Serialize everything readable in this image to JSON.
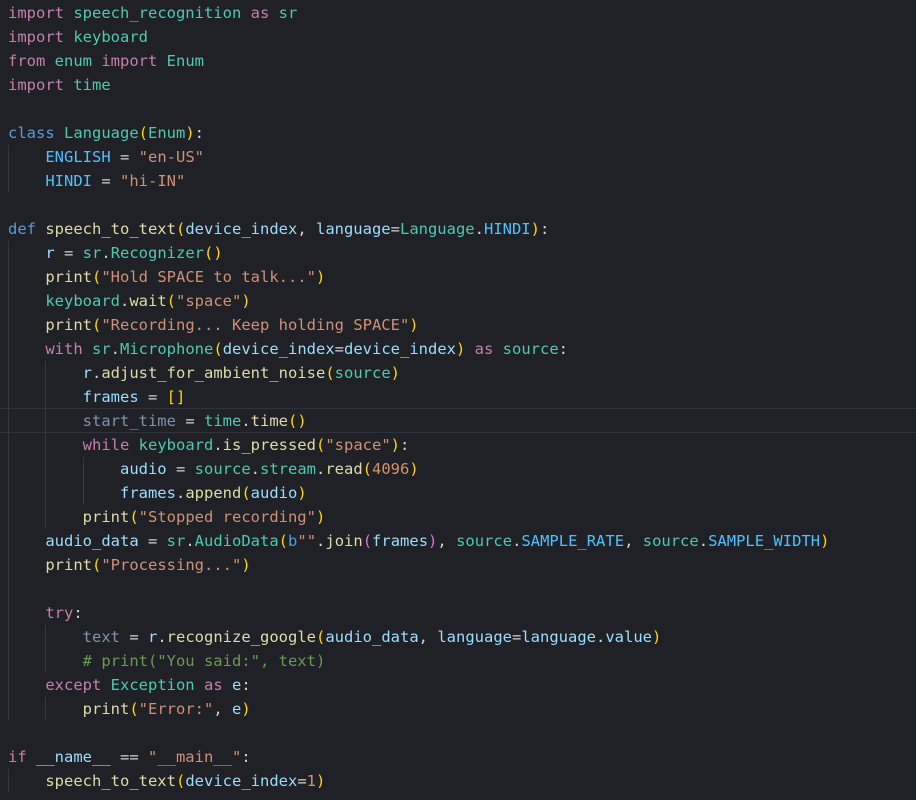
{
  "editor": {
    "kind": "code-editor",
    "language_visual": "python-syntax-highlighted",
    "current_line": 18,
    "palette": {
      "background": "#202127",
      "line_highlight_border": "#30313a",
      "indent_guide": "#36373f",
      "keyword_pink": "#c57fae",
      "keyword_blue": "#569cd6",
      "type_teal": "#4ec9b0",
      "function_yellow": "#dcdcaa",
      "variable_blue": "#9cdcfe",
      "constant_blue": "#4fc1ff",
      "string_salmon": "#ce9178",
      "number_orange": "#d2956b",
      "punctuation": "#d4d4d4",
      "bracket_gold": "#ffd700",
      "bracket_orchid": "#da70d6",
      "comment_green": "#6a9955",
      "unused_dim": "#8093ab"
    },
    "code": {
      "lines": [
        {
          "ind": 0,
          "seg": [
            [
              "k",
              "import "
            ],
            [
              "t",
              "speech_recognition"
            ],
            [
              "k",
              " as "
            ],
            [
              "t",
              "sr"
            ]
          ]
        },
        {
          "ind": 0,
          "seg": [
            [
              "k",
              "import "
            ],
            [
              "t",
              "keyboard"
            ]
          ]
        },
        {
          "ind": 0,
          "seg": [
            [
              "k",
              "from "
            ],
            [
              "t",
              "enum"
            ],
            [
              "k",
              " import "
            ],
            [
              "t",
              "Enum"
            ]
          ]
        },
        {
          "ind": 0,
          "seg": [
            [
              "k",
              "import "
            ],
            [
              "t",
              "time"
            ]
          ]
        },
        {
          "ind": 0,
          "seg": []
        },
        {
          "ind": 0,
          "seg": [
            [
              "d",
              "class "
            ],
            [
              "t",
              "Language"
            ],
            [
              "b1",
              "("
            ],
            [
              "t",
              "Enum"
            ],
            [
              "b1",
              ")"
            ],
            [
              "p",
              ":"
            ]
          ]
        },
        {
          "ind": 4,
          "seg": [
            [
              "c",
              "ENGLISH"
            ],
            [
              "p",
              " = "
            ],
            [
              "s",
              "\"en-US\""
            ]
          ]
        },
        {
          "ind": 4,
          "seg": [
            [
              "c",
              "HINDI"
            ],
            [
              "p",
              " = "
            ],
            [
              "s",
              "\"hi-IN\""
            ]
          ]
        },
        {
          "ind": 0,
          "seg": []
        },
        {
          "ind": 0,
          "seg": [
            [
              "d",
              "def "
            ],
            [
              "f",
              "speech_to_text"
            ],
            [
              "b1",
              "("
            ],
            [
              "v",
              "device_index"
            ],
            [
              "p",
              ", "
            ],
            [
              "v",
              "language"
            ],
            [
              "p",
              "="
            ],
            [
              "t",
              "Language"
            ],
            [
              "p",
              "."
            ],
            [
              "c",
              "HINDI"
            ],
            [
              "b1",
              ")"
            ],
            [
              "p",
              ":"
            ]
          ]
        },
        {
          "ind": 4,
          "seg": [
            [
              "v",
              "r"
            ],
            [
              "p",
              " = "
            ],
            [
              "t",
              "sr"
            ],
            [
              "p",
              "."
            ],
            [
              "t",
              "Recognizer"
            ],
            [
              "b1",
              "()"
            ]
          ]
        },
        {
          "ind": 4,
          "seg": [
            [
              "f",
              "print"
            ],
            [
              "b1",
              "("
            ],
            [
              "s",
              "\"Hold SPACE to talk...\""
            ],
            [
              "b1",
              ")"
            ]
          ]
        },
        {
          "ind": 4,
          "seg": [
            [
              "t",
              "keyboard"
            ],
            [
              "p",
              "."
            ],
            [
              "f",
              "wait"
            ],
            [
              "b1",
              "("
            ],
            [
              "s",
              "\"space\""
            ],
            [
              "b1",
              ")"
            ]
          ]
        },
        {
          "ind": 4,
          "seg": [
            [
              "f",
              "print"
            ],
            [
              "b1",
              "("
            ],
            [
              "s",
              "\"Recording... Keep holding SPACE\""
            ],
            [
              "b1",
              ")"
            ]
          ]
        },
        {
          "ind": 4,
          "seg": [
            [
              "k",
              "with "
            ],
            [
              "t",
              "sr"
            ],
            [
              "p",
              "."
            ],
            [
              "t",
              "Microphone"
            ],
            [
              "b1",
              "("
            ],
            [
              "v",
              "device_index"
            ],
            [
              "p",
              "="
            ],
            [
              "v",
              "device_index"
            ],
            [
              "b1",
              ")"
            ],
            [
              "k",
              " as "
            ],
            [
              "t",
              "source"
            ],
            [
              "p",
              ":"
            ]
          ]
        },
        {
          "ind": 8,
          "seg": [
            [
              "v",
              "r"
            ],
            [
              "p",
              "."
            ],
            [
              "f",
              "adjust_for_ambient_noise"
            ],
            [
              "b1",
              "("
            ],
            [
              "t",
              "source"
            ],
            [
              "b1",
              ")"
            ]
          ]
        },
        {
          "ind": 8,
          "seg": [
            [
              "v",
              "frames"
            ],
            [
              "p",
              " = "
            ],
            [
              "b1",
              "[]"
            ]
          ]
        },
        {
          "ind": 8,
          "seg": [
            [
              "u",
              "start_time"
            ],
            [
              "p",
              " = "
            ],
            [
              "t",
              "time"
            ],
            [
              "p",
              "."
            ],
            [
              "f",
              "time"
            ],
            [
              "b1",
              "()"
            ]
          ]
        },
        {
          "ind": 8,
          "seg": [
            [
              "k",
              "while "
            ],
            [
              "t",
              "keyboard"
            ],
            [
              "p",
              "."
            ],
            [
              "f",
              "is_pressed"
            ],
            [
              "b1",
              "("
            ],
            [
              "s",
              "\"space\""
            ],
            [
              "b1",
              ")"
            ],
            [
              "p",
              ":"
            ]
          ]
        },
        {
          "ind": 12,
          "seg": [
            [
              "v",
              "audio"
            ],
            [
              "p",
              " = "
            ],
            [
              "t",
              "source"
            ],
            [
              "p",
              "."
            ],
            [
              "t",
              "stream"
            ],
            [
              "p",
              "."
            ],
            [
              "f",
              "read"
            ],
            [
              "b1",
              "("
            ],
            [
              "n",
              "4096"
            ],
            [
              "b1",
              ")"
            ]
          ]
        },
        {
          "ind": 12,
          "seg": [
            [
              "v",
              "frames"
            ],
            [
              "p",
              "."
            ],
            [
              "f",
              "append"
            ],
            [
              "b1",
              "("
            ],
            [
              "v",
              "audio"
            ],
            [
              "b1",
              ")"
            ]
          ]
        },
        {
          "ind": 8,
          "seg": [
            [
              "f",
              "print"
            ],
            [
              "b1",
              "("
            ],
            [
              "s",
              "\"Stopped recording\""
            ],
            [
              "b1",
              ")"
            ]
          ]
        },
        {
          "ind": 4,
          "seg": [
            [
              "v",
              "audio_data"
            ],
            [
              "p",
              " = "
            ],
            [
              "t",
              "sr"
            ],
            [
              "p",
              "."
            ],
            [
              "t",
              "AudioData"
            ],
            [
              "b1",
              "("
            ],
            [
              "d",
              "b"
            ],
            [
              "s",
              "\"\""
            ],
            [
              "p",
              "."
            ],
            [
              "f",
              "join"
            ],
            [
              "b2",
              "("
            ],
            [
              "v",
              "frames"
            ],
            [
              "b2",
              ")"
            ],
            [
              "p",
              ", "
            ],
            [
              "t",
              "source"
            ],
            [
              "p",
              "."
            ],
            [
              "c",
              "SAMPLE_RATE"
            ],
            [
              "p",
              ", "
            ],
            [
              "t",
              "source"
            ],
            [
              "p",
              "."
            ],
            [
              "c",
              "SAMPLE_WIDTH"
            ],
            [
              "b1",
              ")"
            ]
          ]
        },
        {
          "ind": 4,
          "seg": [
            [
              "f",
              "print"
            ],
            [
              "b1",
              "("
            ],
            [
              "s",
              "\"Processing...\""
            ],
            [
              "b1",
              ")"
            ]
          ]
        },
        {
          "ind": 0,
          "g": 1,
          "seg": []
        },
        {
          "ind": 4,
          "seg": [
            [
              "k",
              "try"
            ],
            [
              "p",
              ":"
            ]
          ]
        },
        {
          "ind": 8,
          "seg": [
            [
              "u",
              "text"
            ],
            [
              "p",
              " = "
            ],
            [
              "v",
              "r"
            ],
            [
              "p",
              "."
            ],
            [
              "f",
              "recognize_google"
            ],
            [
              "b1",
              "("
            ],
            [
              "v",
              "audio_data"
            ],
            [
              "p",
              ", "
            ],
            [
              "v",
              "language"
            ],
            [
              "p",
              "="
            ],
            [
              "v",
              "language"
            ],
            [
              "p",
              "."
            ],
            [
              "v",
              "value"
            ],
            [
              "b1",
              ")"
            ]
          ]
        },
        {
          "ind": 8,
          "seg": [
            [
              "cm",
              "# print(\"You said:\", text)"
            ]
          ]
        },
        {
          "ind": 4,
          "seg": [
            [
              "k",
              "except "
            ],
            [
              "t",
              "Exception"
            ],
            [
              "k",
              " as "
            ],
            [
              "v",
              "e"
            ],
            [
              "p",
              ":"
            ]
          ]
        },
        {
          "ind": 8,
          "seg": [
            [
              "f",
              "print"
            ],
            [
              "b1",
              "("
            ],
            [
              "s",
              "\"Error:\""
            ],
            [
              "p",
              ", "
            ],
            [
              "v",
              "e"
            ],
            [
              "b1",
              ")"
            ]
          ]
        },
        {
          "ind": 0,
          "seg": []
        },
        {
          "ind": 0,
          "seg": [
            [
              "k",
              "if "
            ],
            [
              "v",
              "__name__"
            ],
            [
              "p",
              " == "
            ],
            [
              "s",
              "\"__main__\""
            ],
            [
              "p",
              ":"
            ]
          ]
        },
        {
          "ind": 4,
          "seg": [
            [
              "f",
              "speech_to_text"
            ],
            [
              "b1",
              "("
            ],
            [
              "v",
              "device_index"
            ],
            [
              "p",
              "="
            ],
            [
              "n",
              "1"
            ],
            [
              "b1",
              ")"
            ]
          ]
        }
      ]
    }
  }
}
